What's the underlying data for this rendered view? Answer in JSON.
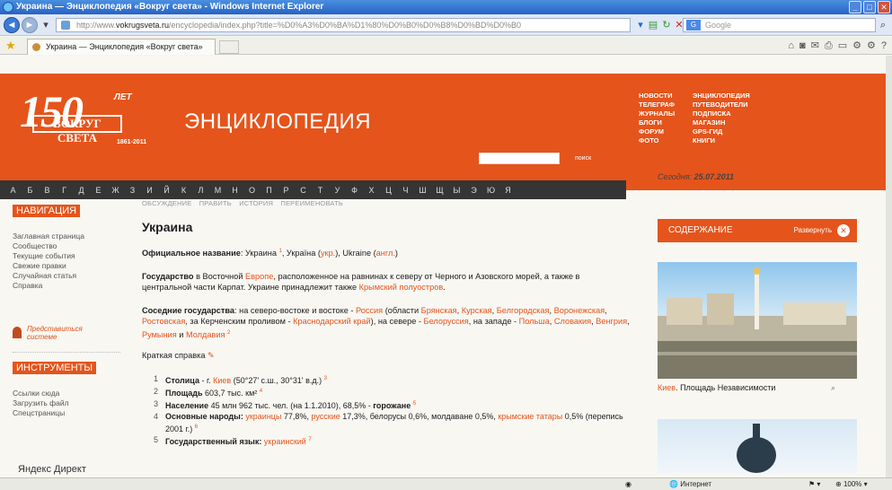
{
  "window": {
    "title": "Украина — Энциклопедия «Вокруг света» - Windows Internet Explorer"
  },
  "address": {
    "prefix": "http://www.",
    "domain": "vokrugsveta.ru",
    "rest": "/encyclopedia/index.php?title=%D0%A3%D0%BA%D1%80%D0%B0%D0%B8%D0%BD%D0%B0",
    "search_placeholder": "Google"
  },
  "tab": {
    "label": "Украина — Энциклопедия «Вокруг света»"
  },
  "header": {
    "logo_number": "150",
    "logo_let": "ЛЕТ",
    "logo_brand": "ВОКРУГ СВЕТА",
    "logo_years": "1861-2011",
    "section_title": "ЭНЦИКЛОПЕДИЯ",
    "search_button": "поиск",
    "nav": [
      "НОВОСТИ",
      "ЭНЦИКЛОПЕДИЯ",
      "ТЕЛЕГРАФ",
      "ПУТЕВОДИТЕЛИ",
      "ЖУРНАЛЫ",
      "ПОДПИСКА",
      "БЛОГИ",
      "МАГАЗИН",
      "ФОРУМ",
      "GPS-ГИД",
      "ФОТО",
      "КНИГИ"
    ]
  },
  "alphabet": [
    "А",
    "Б",
    "В",
    "Г",
    "Д",
    "Е",
    "Ж",
    "З",
    "И",
    "Й",
    "К",
    "Л",
    "М",
    "Н",
    "О",
    "П",
    "Р",
    "С",
    "Т",
    "У",
    "Ф",
    "Х",
    "Ц",
    "Ч",
    "Ш",
    "Щ",
    "Ы",
    "Э",
    "Ю",
    "Я"
  ],
  "date": {
    "label": "Сегодня:",
    "value": "25.07.2011"
  },
  "sidebar": {
    "nav_title": "НАВИГАЦИЯ",
    "nav_links": [
      "Заглавная страница",
      "Сообщество",
      "Текущие события",
      "Свежие правки",
      "Случайная статья",
      "Справка"
    ],
    "represent": "Представиться системе",
    "tools_title": "ИНСТРУМЕНТЫ",
    "tools_links": [
      "Ссылки сюда",
      "Загрузить файл",
      "Спецстраницы"
    ],
    "yandex": "Яндекс  Директ"
  },
  "article": {
    "tabs": [
      "ОБСУЖДЕНИЕ",
      "ПРАВИТЬ",
      "ИСТОРИЯ",
      "ПЕРЕИМЕНОВАТЬ"
    ],
    "title": "Украина",
    "official_label": "Официальное название",
    "official_1": ": Украина ",
    "sup1": "1",
    "official_2": ", Україна (",
    "official_ukr": "укр.",
    "official_3": "), Ukraine (",
    "official_eng": "англ.",
    "official_4": ")",
    "state_label": "Государство",
    "state_1": " в Восточной ",
    "state_europe": "Европе",
    "state_2": ", расположенное на равнинах к северу от Черного и Азовского морей, а также в центральной части Карпат. Украине принадлежит также ",
    "state_crimea": "Крымский полуостров",
    "state_3": ".",
    "neighbors_label": "Соседние государства",
    "n_1": ": на северо-востоке и востоке - ",
    "n_russia": "Россия",
    "n_2": " (области ",
    "n_bryansk": "Брянская",
    "n_kursk": "Курская",
    "n_belgorod": "Белгородская",
    "n_voronezh": "Воронежская",
    "n_rostov": "Ростовская",
    "n_3": ", за Керченским проливом - ",
    "n_krasnodar": "Краснодарский край",
    "n_4": "), на севере - ",
    "n_belarus": "Белоруссия",
    "n_5": ", на западе - ",
    "n_poland": "Польша",
    "n_slovakia": "Словакия",
    "n_hungary": "Венгрия",
    "n_romania": "Румыния",
    "n_and": " и ",
    "n_moldova": "Молдавия",
    "sup2": "2",
    "brief": "Краткая справка",
    "facts": [
      {
        "n": "1",
        "label": "Столица",
        "text1": " - г. ",
        "link": "Киев",
        "text2": " (50°27' с.ш., 30°31' в.д.)",
        "sup": "3"
      },
      {
        "n": "2",
        "label": "Площадь",
        "text1": " 603,7 тыс. км²",
        "sup": "4"
      },
      {
        "n": "3",
        "label": "Население",
        "text1": " 45 млн 962 тыс. чел. (на 1.1.2010), 68,5% - ",
        "label2": "горожане",
        "sup": "5"
      },
      {
        "n": "4",
        "label": "Основные народы:",
        "link1": "украинцы",
        "t1": " 77,8%, ",
        "link2": "русские",
        "t2": " 17,3%, белорусы 0,6%, молдаване 0,5%, ",
        "link3": "крымские татары",
        "t3": " 0,5% (перепись 2001 г.)",
        "sup": "6"
      },
      {
        "n": "5",
        "label": "Государственный язык:",
        "link": "украинский",
        "sup": "7"
      }
    ]
  },
  "contents": {
    "title": "СОДЕРЖАНИЕ",
    "expand": "Развернуть"
  },
  "photo": {
    "caption_link": "Киев",
    "caption_text": ". Площадь Независимости"
  },
  "status": {
    "zone": "Интернет",
    "zoom": "100%"
  }
}
